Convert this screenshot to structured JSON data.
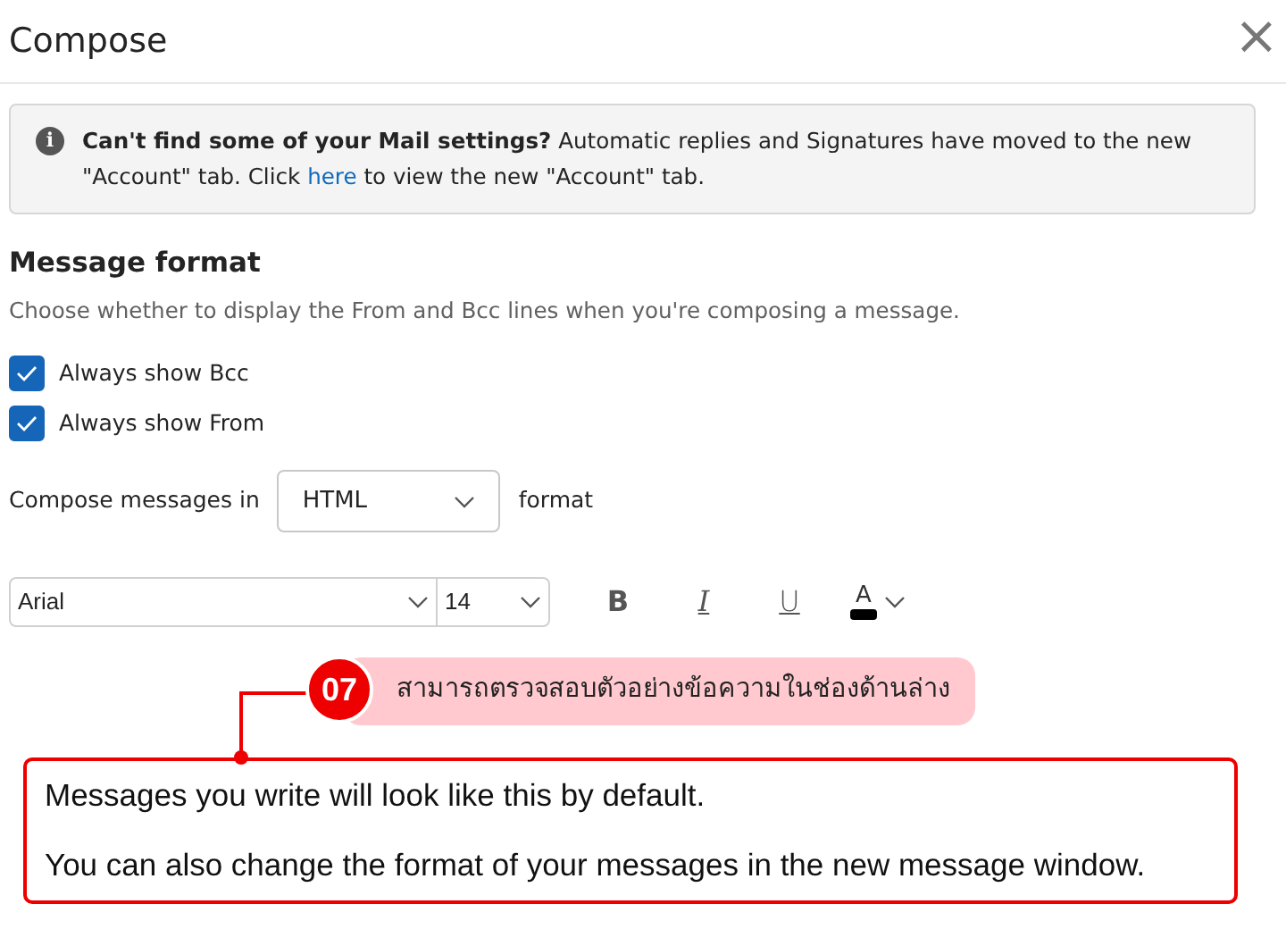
{
  "dialog": {
    "title": "Compose",
    "close_label": "×"
  },
  "info": {
    "icon": "i",
    "before": "**Can't find some of your Mail settings?** Automatic replies and Signatures have moved to the new \"Account\" tab. Click",
    "link": "here",
    "after": "to view the new \"Account\" tab."
  },
  "section": {
    "heading": "Message format",
    "description": "Choose whether to display the From and Bcc lines when you're composing a message."
  },
  "options": [
    {
      "label": "Always show Bcc",
      "checked": true
    },
    {
      "label": "Always show From",
      "checked": true
    }
  ],
  "compose_format": {
    "before": "Compose messages in",
    "value": "HTML",
    "after": "format"
  },
  "toolbar": {
    "font": "Arial",
    "size": "14",
    "buttons": [
      {
        "kind": "bold",
        "label": "B"
      },
      {
        "kind": "italic",
        "label": "I"
      },
      {
        "kind": "underline",
        "label": "U"
      },
      {
        "kind": "font_color",
        "label": "A"
      }
    ]
  },
  "annotation": {
    "step": "07",
    "text": "สามารถตรวจสอบตัวอย่างข้อความในช่องด้านล่าง"
  },
  "preview": [
    "Messages you write will look like this by default.",
    "You can also change the format of your messages in the new message window."
  ]
}
